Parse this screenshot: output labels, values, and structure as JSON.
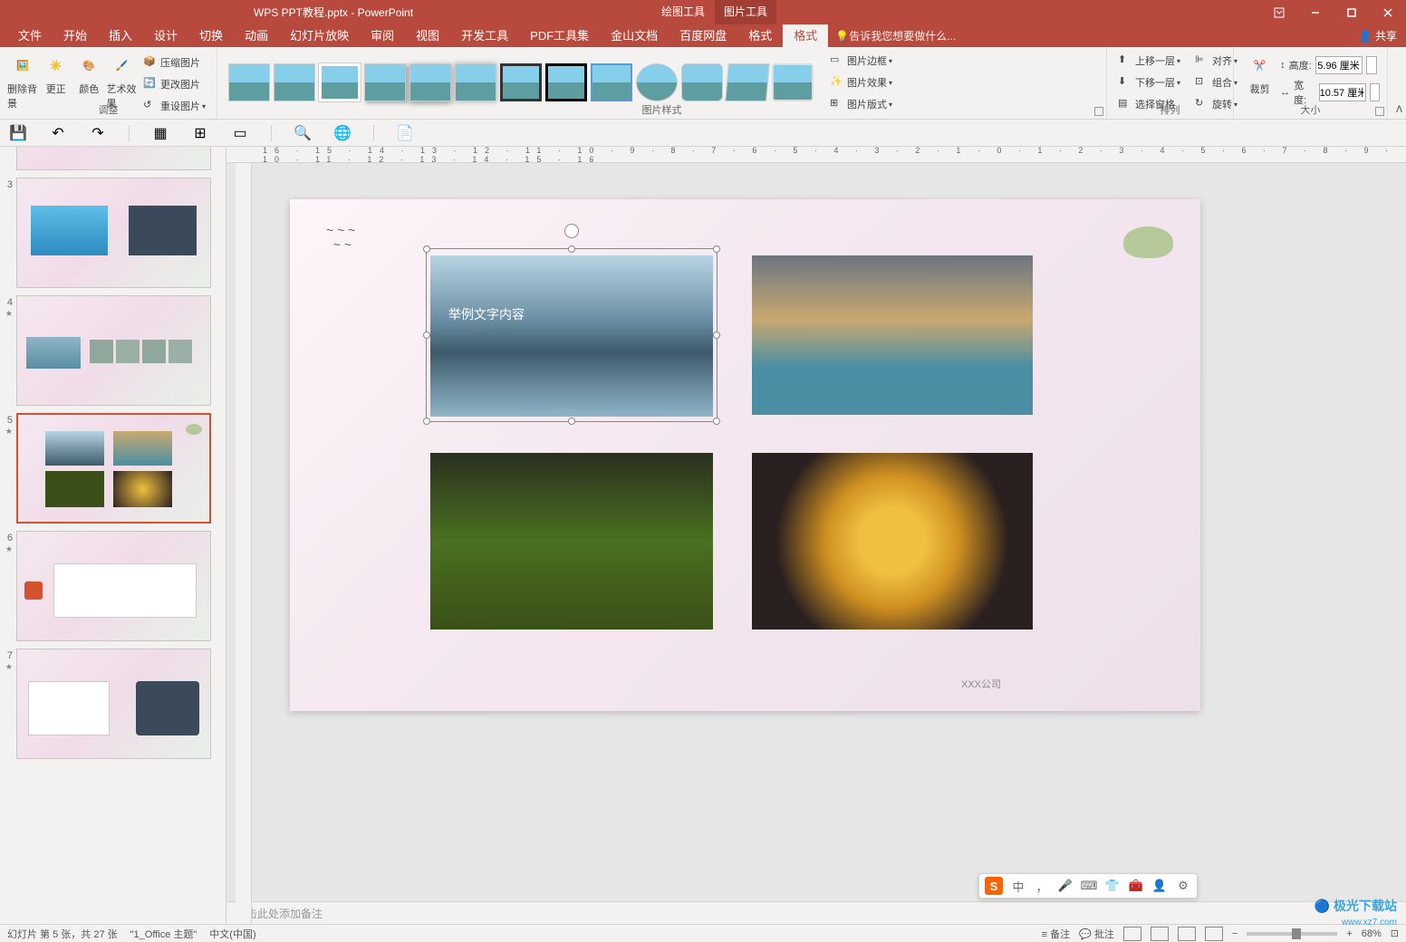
{
  "titlebar": {
    "filename": "WPS PPT教程.pptx - PowerPoint",
    "tool_tabs": [
      "绘图工具",
      "图片工具"
    ]
  },
  "share": "共享",
  "menu": {
    "items": [
      "文件",
      "开始",
      "插入",
      "设计",
      "切换",
      "动画",
      "幻灯片放映",
      "审阅",
      "视图",
      "开发工具",
      "PDF工具集",
      "金山文档",
      "百度网盘",
      "格式",
      "格式"
    ],
    "active_index": 14,
    "tell_me": "告诉我您想要做什么..."
  },
  "ribbon": {
    "adjust": {
      "label": "调整",
      "remove_bg": "删除背景",
      "corrections": "更正",
      "color": "颜色",
      "artistic": "艺术效果",
      "compress": "压缩图片",
      "change": "更改图片",
      "reset": "重设图片"
    },
    "styles": {
      "label": "图片样式",
      "border": "图片边框",
      "effects": "图片效果",
      "layout": "图片版式"
    },
    "arrange": {
      "label": "排列",
      "bring_forward": "上移一层",
      "send_backward": "下移一层",
      "selection_pane": "选择窗格",
      "align": "对齐",
      "group": "组合",
      "rotate": "旋转"
    },
    "size": {
      "label": "大小",
      "crop": "裁剪",
      "height_label": "高度:",
      "height_value": "5.96 厘米",
      "width_label": "宽度:",
      "width_value": "10.57 厘米"
    }
  },
  "ruler": "16 · 15 · 14 · 13 · 12 · 11 · 10 · 9 · 8 · 7 · 6 · 5 · 4 · 3 · 2 · 1 · 0 · 1 · 2 · 3 · 4 · 5 · 6 · 7 · 8 · 9 · 10 · 11 · 12 · 13 · 14 · 15 · 16",
  "slides": {
    "visible": [
      3,
      4,
      5,
      6,
      7
    ],
    "selected": 5
  },
  "canvas": {
    "img1_text": "举例文字内容",
    "footer": "XXX公司"
  },
  "notes_placeholder": "单击此处添加备注",
  "ime": {
    "lang": "中"
  },
  "status": {
    "slide_info": "幻灯片 第 5 张，共 27 张",
    "theme": "\"1_Office 主题\"",
    "lang": "中文(中国)",
    "notes": "备注",
    "comments": "批注",
    "zoom": "68%"
  },
  "watermark": {
    "main": "极光下载站",
    "sub": "www.xz7.com"
  }
}
